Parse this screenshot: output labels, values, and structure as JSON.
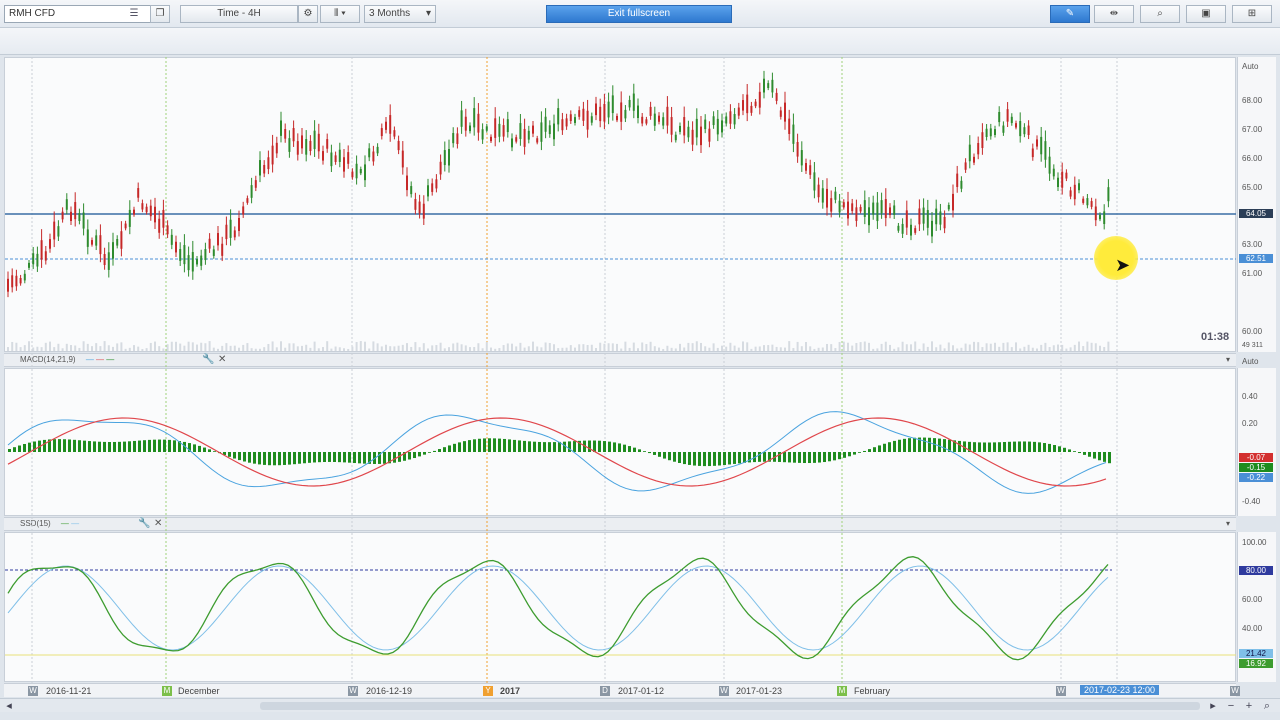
{
  "toolbar": {
    "symbol": "RMH CFD",
    "timeframe": "Time - 4H",
    "range": "3 Months",
    "exit_fullscreen": "Exit fullscreen"
  },
  "price_panel": {
    "y_ticks": [
      "Auto",
      "68.00",
      "67.00",
      "66.00",
      "65.00",
      "64.05",
      "63.00",
      "62.51",
      "61.00",
      "60.00"
    ],
    "current_price": "64.05",
    "crosshair_price": "62.51",
    "volume_label": "49 311",
    "countdown": "01:38",
    "colors": {
      "up": "#2e8b2e",
      "down": "#c62828",
      "hline": "#3a6ea5"
    }
  },
  "macd_panel": {
    "label": "MACD(14,21,9)",
    "y_ticks": [
      "Auto",
      "0.40",
      "0.20",
      "-0.40",
      "-0.20"
    ],
    "values": [
      "-0.07",
      "-0.15",
      "-0.22"
    ],
    "colors": {
      "hist": "#1e8c1e",
      "signal": "#e0474c",
      "macd": "#4aa3df"
    }
  },
  "ssd_panel": {
    "label": "SSD(15)",
    "y_ticks": [
      "100.00",
      "80.00",
      "60.00",
      "40.00",
      "21.42",
      "16.92"
    ],
    "level": "80.00",
    "colors": {
      "k": "#3d9c2f",
      "d": "#7fbfe8",
      "level_line": "#2e3a9e"
    }
  },
  "time_axis": {
    "labels": [
      "2016-11-21",
      "December",
      "2016-12-19",
      "2017",
      "2017-01-12",
      "2017-01-23",
      "February",
      "2017-02-23 12:00"
    ],
    "markers": [
      "W",
      "M",
      "W",
      "Y",
      "D",
      "W",
      "M",
      "W",
      "W"
    ]
  }
}
